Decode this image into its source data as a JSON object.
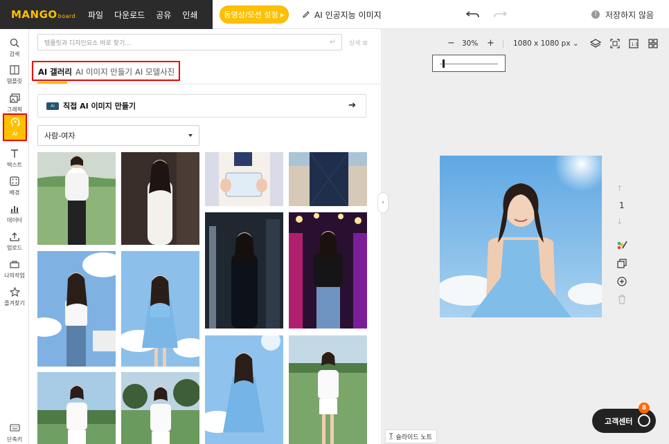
{
  "app": {
    "logo_text": "MANGO",
    "logo_sub": "board"
  },
  "menu": [
    "파일",
    "다운로드",
    "공유",
    "인쇄"
  ],
  "motion_button": "동영상/모션 설정 ▸",
  "ai_image_link": "AI 인공지능 이미지",
  "save_status": "저장하지 않음",
  "rail": [
    {
      "label": "검색",
      "icon": "search-icon"
    },
    {
      "label": "템플릿",
      "icon": "template-icon"
    },
    {
      "label": "그래픽",
      "icon": "graphic-icon"
    },
    {
      "label": "AI",
      "icon": "ai-icon"
    },
    {
      "label": "텍스트",
      "icon": "text-icon"
    },
    {
      "label": "배경",
      "icon": "background-icon"
    },
    {
      "label": "데이터",
      "icon": "chart-icon"
    },
    {
      "label": "업로드",
      "icon": "upload-icon"
    },
    {
      "label": "나의작업",
      "icon": "my-work-icon"
    },
    {
      "label": "즐겨찾기",
      "icon": "star-icon"
    },
    {
      "label": "단축키",
      "icon": "keyboard-icon"
    }
  ],
  "panel": {
    "search_placeholder": "템플릿과 디자인요소 바로 찾기...",
    "detail_label": "상세",
    "tabs": [
      "AI 갤러리",
      "AI 이미지 만들기",
      "AI 모델사진"
    ],
    "make_ai_badge": "AI",
    "make_ai_label": "직접 AI 이미지 만들기",
    "category": "사람-여자"
  },
  "canvas": {
    "zoom": "30%",
    "size": "1080 x 1080 px",
    "page_number": "1",
    "slide_note": "슬라이드 노트"
  },
  "support": {
    "label": "고객센터",
    "badge": "8"
  }
}
